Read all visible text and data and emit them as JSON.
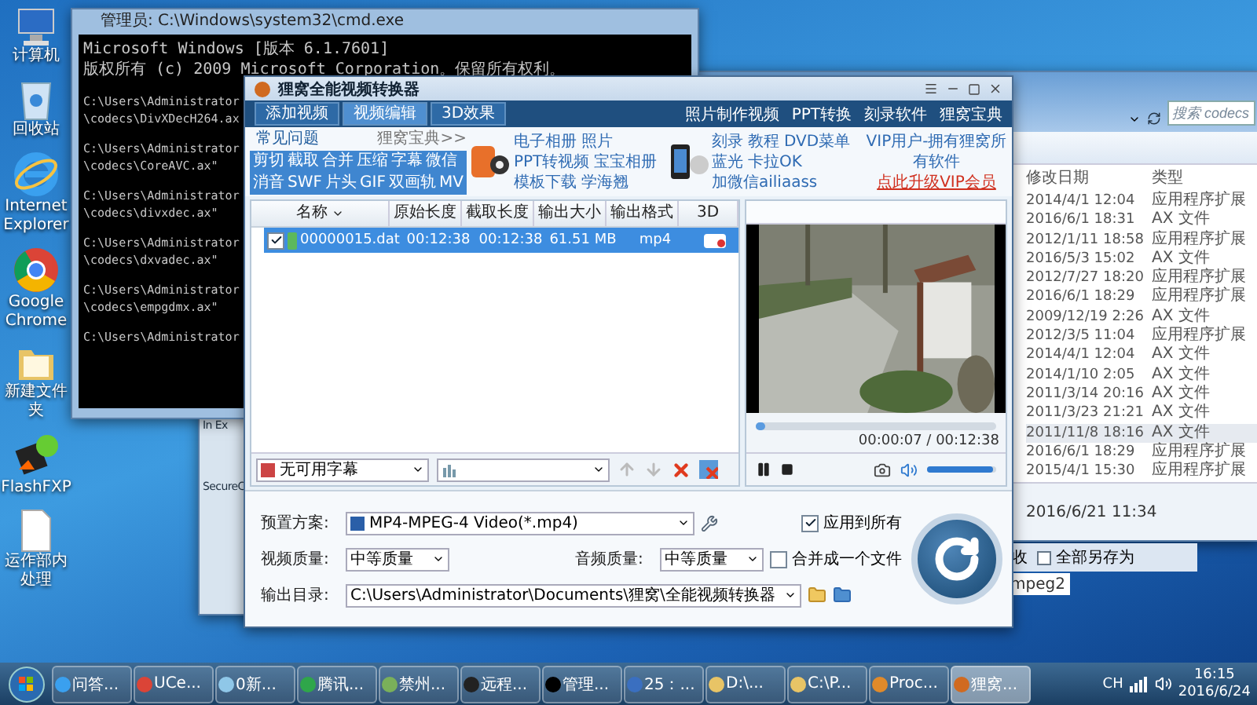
{
  "desktop_icons": [
    {
      "label": "计算机",
      "kind": "computer"
    },
    {
      "label": "回收站",
      "kind": "bin"
    },
    {
      "label": "Internet Explorer",
      "kind": "ie"
    },
    {
      "label": "Google Chrome",
      "kind": "chrome"
    },
    {
      "label": "新建文件夹",
      "kind": "folder"
    },
    {
      "label": "FlashFXP",
      "kind": "ftp"
    },
    {
      "label": "运作部内处理",
      "kind": "file"
    }
  ],
  "cmd_window": {
    "title": "管理员: C:\\Windows\\system32\\cmd.exe",
    "header_lines": [
      "Microsoft Windows [版本 6.1.7601]",
      "版权所有 (c) 2009 Microsoft Corporation。保留所有权利。"
    ],
    "blocks": [
      [
        "C:\\Users\\Administrator",
        "\\codecs\\DivXDecH264.ax"
      ],
      [
        "C:\\Users\\Administrator",
        "\\codecs\\CoreAVC.ax\""
      ],
      [
        "C:\\Users\\Administrator",
        "\\codecs\\divxdec.ax\""
      ],
      [
        "C:\\Users\\Administrator",
        "\\codecs\\dxvadec.ax\""
      ],
      [
        "C:\\Users\\Administrator",
        "\\codecs\\empgdmx.ax\""
      ],
      [
        "C:\\Users\\Administrator"
      ]
    ]
  },
  "back_window": {
    "labels": [
      "In Ex",
      "SecureC"
    ]
  },
  "explorer": {
    "search_placeholder": "搜索 codecs",
    "columns": [
      "修改日期",
      "类型"
    ],
    "rows": [
      {
        "date": "2014/4/1 12:04",
        "type": "应用程序扩展",
        "selected": false
      },
      {
        "date": "2016/6/1 18:31",
        "type": "AX 文件",
        "selected": false
      },
      {
        "date": "2012/1/11 18:58",
        "type": "应用程序扩展",
        "selected": false
      },
      {
        "date": "2016/5/3 15:02",
        "type": "AX 文件",
        "selected": false
      },
      {
        "date": "2012/7/27 18:20",
        "type": "应用程序扩展",
        "selected": false
      },
      {
        "date": "2016/6/1 18:29",
        "type": "应用程序扩展",
        "selected": false
      },
      {
        "date": "2009/12/19 2:26",
        "type": "AX 文件",
        "selected": false
      },
      {
        "date": "2012/3/5 11:04",
        "type": "应用程序扩展",
        "selected": false
      },
      {
        "date": "2014/4/1 12:04",
        "type": "AX 文件",
        "selected": false
      },
      {
        "date": "2014/1/10 2:05",
        "type": "AX 文件",
        "selected": false
      },
      {
        "date": "2011/3/14 20:16",
        "type": "AX 文件",
        "selected": false
      },
      {
        "date": "2011/3/23 21:21",
        "type": "AX 文件",
        "selected": false
      },
      {
        "date": "2011/11/8 18:16",
        "type": "AX 文件",
        "selected": true
      },
      {
        "date": "2016/6/1 18:29",
        "type": "应用程序扩展",
        "selected": false
      },
      {
        "date": "2015/4/1 15:30",
        "type": "应用程序扩展",
        "selected": false
      }
    ],
    "details": "2016/6/21 11:34"
  },
  "save_bar": {
    "items": [
      "收",
      "全部另存为"
    ]
  },
  "side_label": "mpeg2",
  "converter": {
    "title": "狸窝全能视频转换器",
    "tabs": [
      {
        "label": "添加视频",
        "selected": false
      },
      {
        "label": "视频编辑",
        "selected": true
      },
      {
        "label": "3D效果",
        "selected": false
      }
    ],
    "top_links": [
      "照片制作视频",
      "PPT转换",
      "刻录软件",
      "狸窝宝典"
    ],
    "faq": {
      "tab": "常见问题",
      "more": "狸窝宝典>>",
      "words": [
        "剪切",
        "截取",
        "合并",
        "压缩",
        "字幕",
        "微信",
        "消音",
        "SWF",
        "片头",
        "GIF",
        "双画轨",
        "MV"
      ]
    },
    "ad_groups": [
      {
        "kind": "ppt",
        "words": [
          "电子相册",
          "照片",
          "PPT转视频",
          "宝宝相册",
          "模板下载",
          "学海翘"
        ]
      },
      {
        "kind": "phone",
        "words": [
          "刻录",
          "教程",
          "DVD菜单",
          "蓝光",
          "卡拉OK",
          "加微信ailiaass"
        ]
      }
    ],
    "vip": {
      "text": "VIP用户-拥有狸窝所有软件",
      "link": "点此升级VIP会员"
    },
    "columns": [
      "名称",
      "原始长度",
      "截取长度",
      "输出大小",
      "输出格式",
      "3D"
    ],
    "files": [
      {
        "name": "00000015.dat",
        "original": "00:12:38",
        "clip": "00:12:38",
        "size": "61.51 MB",
        "format": "mp4",
        "checked": true,
        "selected": true
      }
    ],
    "subtitle": "无可用字幕",
    "preview": {
      "progress": {
        "level": 0.03
      },
      "time": "00:00:07 / 00:12:38",
      "volume": {
        "level": 0.95
      }
    },
    "preset_label": "预置方案:",
    "preset": "MP4-MPEG-4 Video(*.mp4)",
    "apply_all": {
      "label": "应用到所有",
      "checked": true
    },
    "video_quality_label": "视频质量:",
    "video_quality": "中等质量",
    "audio_quality_label": "音频质量:",
    "audio_quality": "中等质量",
    "merge": {
      "label": "合并成一个文件",
      "checked": false
    },
    "output_label": "输出目录:",
    "output": "C:\\Users\\Administrator\\Documents\\狸窝\\全能视频转换器"
  },
  "taskbar": {
    "items": [
      {
        "label": "问答...",
        "kind": "ie",
        "active": false
      },
      {
        "label": "UCe...",
        "kind": "chrome",
        "active": false
      },
      {
        "label": "0新...",
        "kind": "note",
        "active": false
      },
      {
        "label": "腾讯...",
        "kind": "qqbrowser",
        "active": false
      },
      {
        "label": "禁州...",
        "active": false
      },
      {
        "label": "远程...",
        "kind": "qq",
        "active": false
      },
      {
        "label": "管理...",
        "kind": "cmd",
        "active": false
      },
      {
        "label": "25：...",
        "kind": "player",
        "active": false
      },
      {
        "label": "D:\\...",
        "kind": "folder",
        "active": false
      },
      {
        "label": "C:\\P...",
        "kind": "folder",
        "active": false
      },
      {
        "label": "Proc...",
        "kind": "gear",
        "active": false
      },
      {
        "label": "狸窝...",
        "kind": "fox",
        "active": true
      }
    ],
    "lang": "CH",
    "time": "16:15",
    "date": "2016/6/24"
  }
}
